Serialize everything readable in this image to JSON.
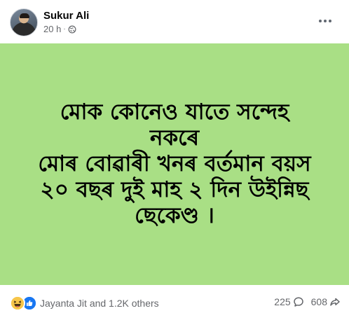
{
  "post": {
    "author": "Sukur Ali",
    "time": "20 h",
    "separator": "·",
    "privacy_icon": "globe-icon",
    "more_icon": "more-horizontal-icon",
    "banner_color": "#a9df85",
    "banner_lines": [
      "মোক কোনেও যাতে সন্দেহ",
      "নকৰে",
      "মোৰ বোৱাৰী খনৰ বৰ্তমান বয়স",
      "২০ বছৰ দুই মাহ ২ দিন উইন্নিছ",
      "ছেকেণ্ড ।"
    ]
  },
  "footer": {
    "reaction_icons": [
      "haha-icon",
      "like-icon"
    ],
    "reactors": "Jayanta Jit and 1.2K others",
    "comments_count": "225",
    "comment_icon": "comment-icon",
    "shares_count": "608",
    "share_icon": "share-icon"
  }
}
